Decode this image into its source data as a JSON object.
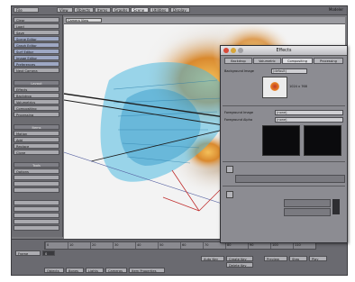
{
  "menu": {
    "file_label": "File",
    "tabs": [
      "View",
      "Objects",
      "Items",
      "Graphs",
      "Scene",
      "Utilities",
      "Display"
    ],
    "active_tab": 4,
    "right_label": "Modeler"
  },
  "sidebar": {
    "items": [
      "Clear",
      "Load",
      "Save",
      "Scene Editor",
      "Graph Editor",
      "Surf Editor",
      "Image Editor",
      "Preferences",
      "Next Camera",
      "Layout",
      "Effects",
      "Backdrop",
      "Volumetrics",
      "Compositing",
      "Processing",
      "Items",
      "Motion",
      "Add",
      "Replace",
      "Clone",
      "Tools",
      "Options"
    ]
  },
  "viewport": {
    "view_select": "Camera View"
  },
  "effects_window": {
    "title": "Effects",
    "tabs": [
      "Backdrop",
      "Volumetric",
      "Compositing",
      "Processing"
    ],
    "active_tab": 2,
    "bg_image_label": "Background Image",
    "bg_image_value": "(default)",
    "fg_image_label": "Foreground Image",
    "fg_image_value": "(none)",
    "fg_alpha_label": "Foreground Alpha",
    "fg_alpha_value": "(none)",
    "preview_caption": "1024 x 768"
  },
  "bottombar": {
    "timeline_ticks": [
      "0",
      "10",
      "20",
      "30",
      "40",
      "50",
      "60",
      "70",
      "80",
      "90",
      "100",
      "110"
    ],
    "frame_label": "Frame",
    "frame_value": "0",
    "buttons": [
      "Objects",
      "Bones",
      "Lights",
      "Cameras",
      "Item Properties"
    ],
    "auto_key": "Auto Key",
    "create_key": "Create Key",
    "delete_key": "Delete Key",
    "preview": "Preview",
    "step": "Step",
    "play": "Play"
  },
  "colors": {
    "panel": "#6d6d72",
    "button": "#a9a9ae",
    "accent_blue": "#4fb9e0",
    "fire_orange": "#e07a2a"
  }
}
